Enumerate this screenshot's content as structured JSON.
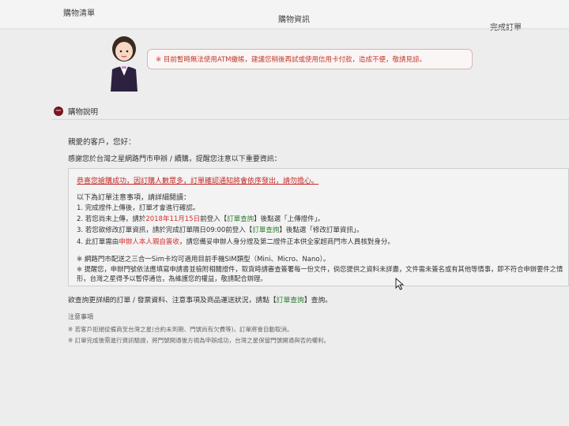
{
  "steps": {
    "cart": "購物清單",
    "info": "購物資訊",
    "done": "完成訂單"
  },
  "bubble": {
    "message": "※ 目前暫時無法使用ATM繳帳，建議您稍後再試或使用信用卡付款，造成不便，敬請見諒。"
  },
  "section": {
    "toggle": "−",
    "title": "購物說明"
  },
  "greeting": "親愛的客戶，您好：",
  "intro": "感謝您於台灣之星網路門市申辦 / 續購，提醒您注意以下重要資訊：",
  "alert": "恭喜您搶購成功，因訂購人數眾多，訂單確認通知將會依序發出，請勿擔心。",
  "notice": {
    "title": "以下為訂單注意事項，請詳細閱讀：",
    "item1": "1. 完成證件上傳後，訂單才會進行確認。",
    "item2_pre": "2. 若您尚未上傳，請於",
    "item2_date": "2018年11月15日",
    "item2_mid": "前登入【",
    "item2_link": "訂單查詢",
    "item2_post": "】後點選「上傳證件」。",
    "item3_pre": "3. 若您欲修改訂單資訊，請於完成訂單隔日09:00前登入【",
    "item3_link": "訂單查詢",
    "item3_post": "】後點選「修改訂單資訊」。",
    "item4_pre": "4. 此訂單需由",
    "item4_red": "申辦人本人親自簽收",
    "item4_post": "，請您備妥申辦人身分證及第二證件正本供全家超商門市人員核對身分。"
  },
  "note1": "※ 網路門市配送之三合一Sim卡均可適用目前手機SIM類型（Mini、Micro、Nano）。",
  "note2": "※ 提醒您，申辦門號依法應填寫申請書並檢附相關證件，取貨時請審查簽署每一份文件，倘您提供之資料未詳盡，文件需未簽名或有其他等情事，即不符合申辦要件之情形，台灣之星得予以暫停通信，為維護您的權益，敬請配合辦理。",
  "query": {
    "pre": "欲查詢更詳細的訂單 / 發票資料、注意事項及商品運送狀況，請點【",
    "link": "訂單查詢",
    "post": "】查詢。"
  },
  "caution": {
    "title": "注意事項",
    "item1": "※ 若客戶拒絕從備商至台灣之星(合約未到期、門號尚有欠費等)，訂單將會自動取消。",
    "item2": "※ 訂單完成後需進行資訊驗證，將門號開通後方視為申辦成功，台灣之星保留門號開通與否的權利。"
  },
  "colors": {
    "accent": "#7a1422",
    "alert_red": "#c62828",
    "link_green": "#2e7d32"
  }
}
